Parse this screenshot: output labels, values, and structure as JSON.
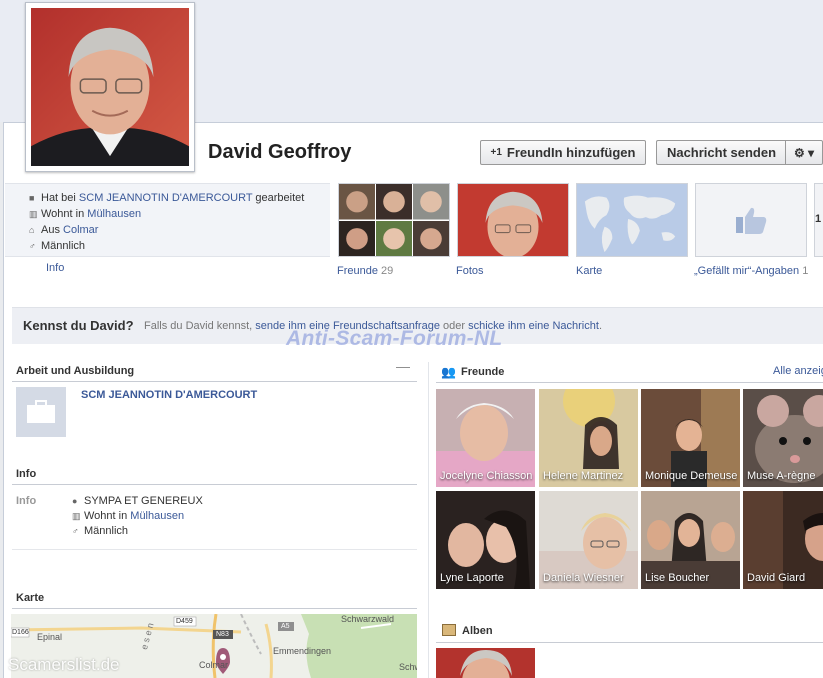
{
  "profile": {
    "name": "David Geoffroy"
  },
  "actions": {
    "add_friend": "FreundIn hinzufügen",
    "add_friend_icon": "+1",
    "send_message": "Nachricht senden",
    "gear": "⚙ ▾"
  },
  "intro": {
    "work_prefix": "Hat bei ",
    "work_employer": "SCM JEANNOTIN D'AMERCOURT",
    "work_suffix": " gearbeitet",
    "lives_prefix": "Wohnt in ",
    "lives_city": "Mülhausen",
    "from_prefix": "Aus ",
    "from_city": "Colmar",
    "gender": "Männlich",
    "info_link": "Info"
  },
  "thumbs": {
    "friends_label": "Freunde",
    "friends_count": "29",
    "photos_label": "Fotos",
    "map_label": "Karte",
    "likes_label": "„Gefällt mir“-Angaben",
    "likes_count": "1",
    "next_count": "1"
  },
  "know_bar": {
    "title": "Kennst du David?",
    "text_1": "Falls du David kennst, ",
    "link_1": "sende ihm eine Freundschaftsanfrage",
    "text_2": " oder ",
    "link_2": "schicke ihm eine Nachricht",
    "text_3": "."
  },
  "watermark": "Anti-Scam-Forum-NL",
  "work_section": {
    "title": "Arbeit und Ausbildung",
    "employer": "SCM JEANNOTIN D'AMERCOURT",
    "collapse": "—"
  },
  "info_section": {
    "title": "Info",
    "label": "Info",
    "motto": "SYMPA ET GENEREUX",
    "lives_prefix": "Wohnt in ",
    "lives_city": "Mülhausen",
    "gender": "Männlich"
  },
  "map_section": {
    "title": "Karte",
    "places": {
      "epinal": "Epinal",
      "schwarzwald": "Schwarzwald",
      "emmendingen": "Emmendingen",
      "colmar": "Colmar",
      "schw": "Schw",
      "road_d459": "D459",
      "road_n83": "N83",
      "road_a5": "A5",
      "road_d166": "D166",
      "vosges_text": "e s e n"
    },
    "overlay_mark": "Scamerslist.de"
  },
  "friends_section": {
    "title": "Freunde",
    "see_all": "Alle anzeig",
    "friends": [
      {
        "name": "Jocelyne Chiasson"
      },
      {
        "name": "Helene Martinez"
      },
      {
        "name": "Monique Demeuse"
      },
      {
        "name": "Muse A-règne"
      },
      {
        "name": "Lyne Laporte"
      },
      {
        "name": "Daniela Wiesner"
      },
      {
        "name": "Lise Boucher"
      },
      {
        "name": "David Giard"
      }
    ]
  },
  "albums_section": {
    "title": "Alben"
  },
  "colors": {
    "link": "#3b5998",
    "band": "#e9ecf3",
    "panel": "#f2f4f8",
    "watermark": "#788cd7"
  }
}
